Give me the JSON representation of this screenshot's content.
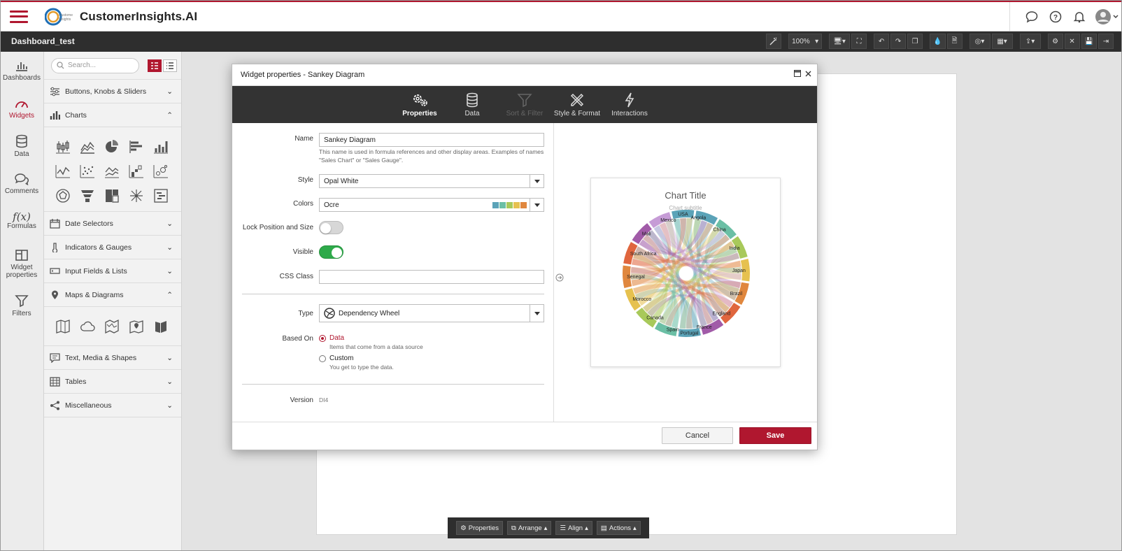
{
  "app": {
    "title": "CustomerInsights.AI",
    "dashboard_name": "Dashboard_test",
    "brand_color": "#b0172f"
  },
  "toolbar": {
    "zoom": "100%"
  },
  "rail": {
    "items": [
      {
        "label": "Dashboards",
        "icon": "bar-chart-icon"
      },
      {
        "label": "Widgets",
        "icon": "gauge-icon"
      },
      {
        "label": "Data",
        "icon": "database-icon"
      },
      {
        "label": "Comments",
        "icon": "comments-icon"
      },
      {
        "label": "Formulas",
        "icon": "function-icon",
        "glyph": "f(x)"
      },
      {
        "label": "Widget properties",
        "icon": "widget-layout-icon"
      },
      {
        "label": "Filters",
        "icon": "filter-icon"
      }
    ]
  },
  "panel": {
    "search_placeholder": "Search...",
    "sections": [
      "Buttons, Knobs & Sliders",
      "Charts",
      "Date Selectors",
      "Indicators & Gauges",
      "Input Fields & Lists",
      "Maps & Diagrams",
      "Text, Media & Shapes",
      "Tables",
      "Miscellaneous"
    ]
  },
  "modal": {
    "title": "Widget properties - Sankey Diagram",
    "tabs": [
      "Properties",
      "Data",
      "Sort & Filter",
      "Style & Format",
      "Interactions"
    ],
    "form": {
      "name_label": "Name",
      "name_value": "Sankey Diagram",
      "name_help": "This name is used in formula references and other display areas. Examples of names \"Sales Chart\" or \"Sales Gauge\".",
      "style_label": "Style",
      "style_value": "Opal White",
      "colors_label": "Colors",
      "colors_value": "Ocre",
      "swatches": [
        "#5ba3b8",
        "#6bbfa5",
        "#a8c95a",
        "#e6c14f",
        "#e0873e"
      ],
      "lock_label": "Lock Position and Size",
      "lock_on": false,
      "visible_label": "Visible",
      "visible_on": true,
      "css_label": "CSS Class",
      "css_value": "",
      "type_label": "Type",
      "type_value": "Dependency Wheel",
      "based_label": "Based On",
      "based_options": [
        {
          "label": "Data",
          "desc": "Items that come from a data source",
          "selected": true
        },
        {
          "label": "Custom",
          "desc": "You get to type the data.",
          "selected": false
        }
      ],
      "version_label": "Version",
      "version_value": "DI4"
    },
    "preview": {
      "chart_title": "Chart Title",
      "chart_subtitle": "Chart subtitle",
      "nodes": [
        {
          "name": "USA",
          "color": "#5ba3b8"
        },
        {
          "name": "Angola",
          "color": "#5ba3b8"
        },
        {
          "name": "China",
          "color": "#6bbfa5"
        },
        {
          "name": "India",
          "color": "#a8c95a"
        },
        {
          "name": "Japan",
          "color": "#e6c14f"
        },
        {
          "name": "Brazil",
          "color": "#e0873e"
        },
        {
          "name": "England",
          "color": "#e0663e"
        },
        {
          "name": "France",
          "color": "#a15ba8"
        },
        {
          "name": "Portugal",
          "color": "#5ba3b8"
        },
        {
          "name": "Spain",
          "color": "#6bbfa5"
        },
        {
          "name": "Canada",
          "color": "#a8c95a"
        },
        {
          "name": "Morocco",
          "color": "#e6c14f"
        },
        {
          "name": "Senegal",
          "color": "#e0873e"
        },
        {
          "name": "South Africa",
          "color": "#e0663e"
        },
        {
          "name": "Mali",
          "color": "#a15ba8"
        },
        {
          "name": "Mexico",
          "color": "#c69cd6"
        }
      ]
    },
    "cancel_label": "Cancel",
    "save_label": "Save"
  },
  "bottom_bar": [
    "Properties",
    "Arrange",
    "Align",
    "Actions"
  ]
}
